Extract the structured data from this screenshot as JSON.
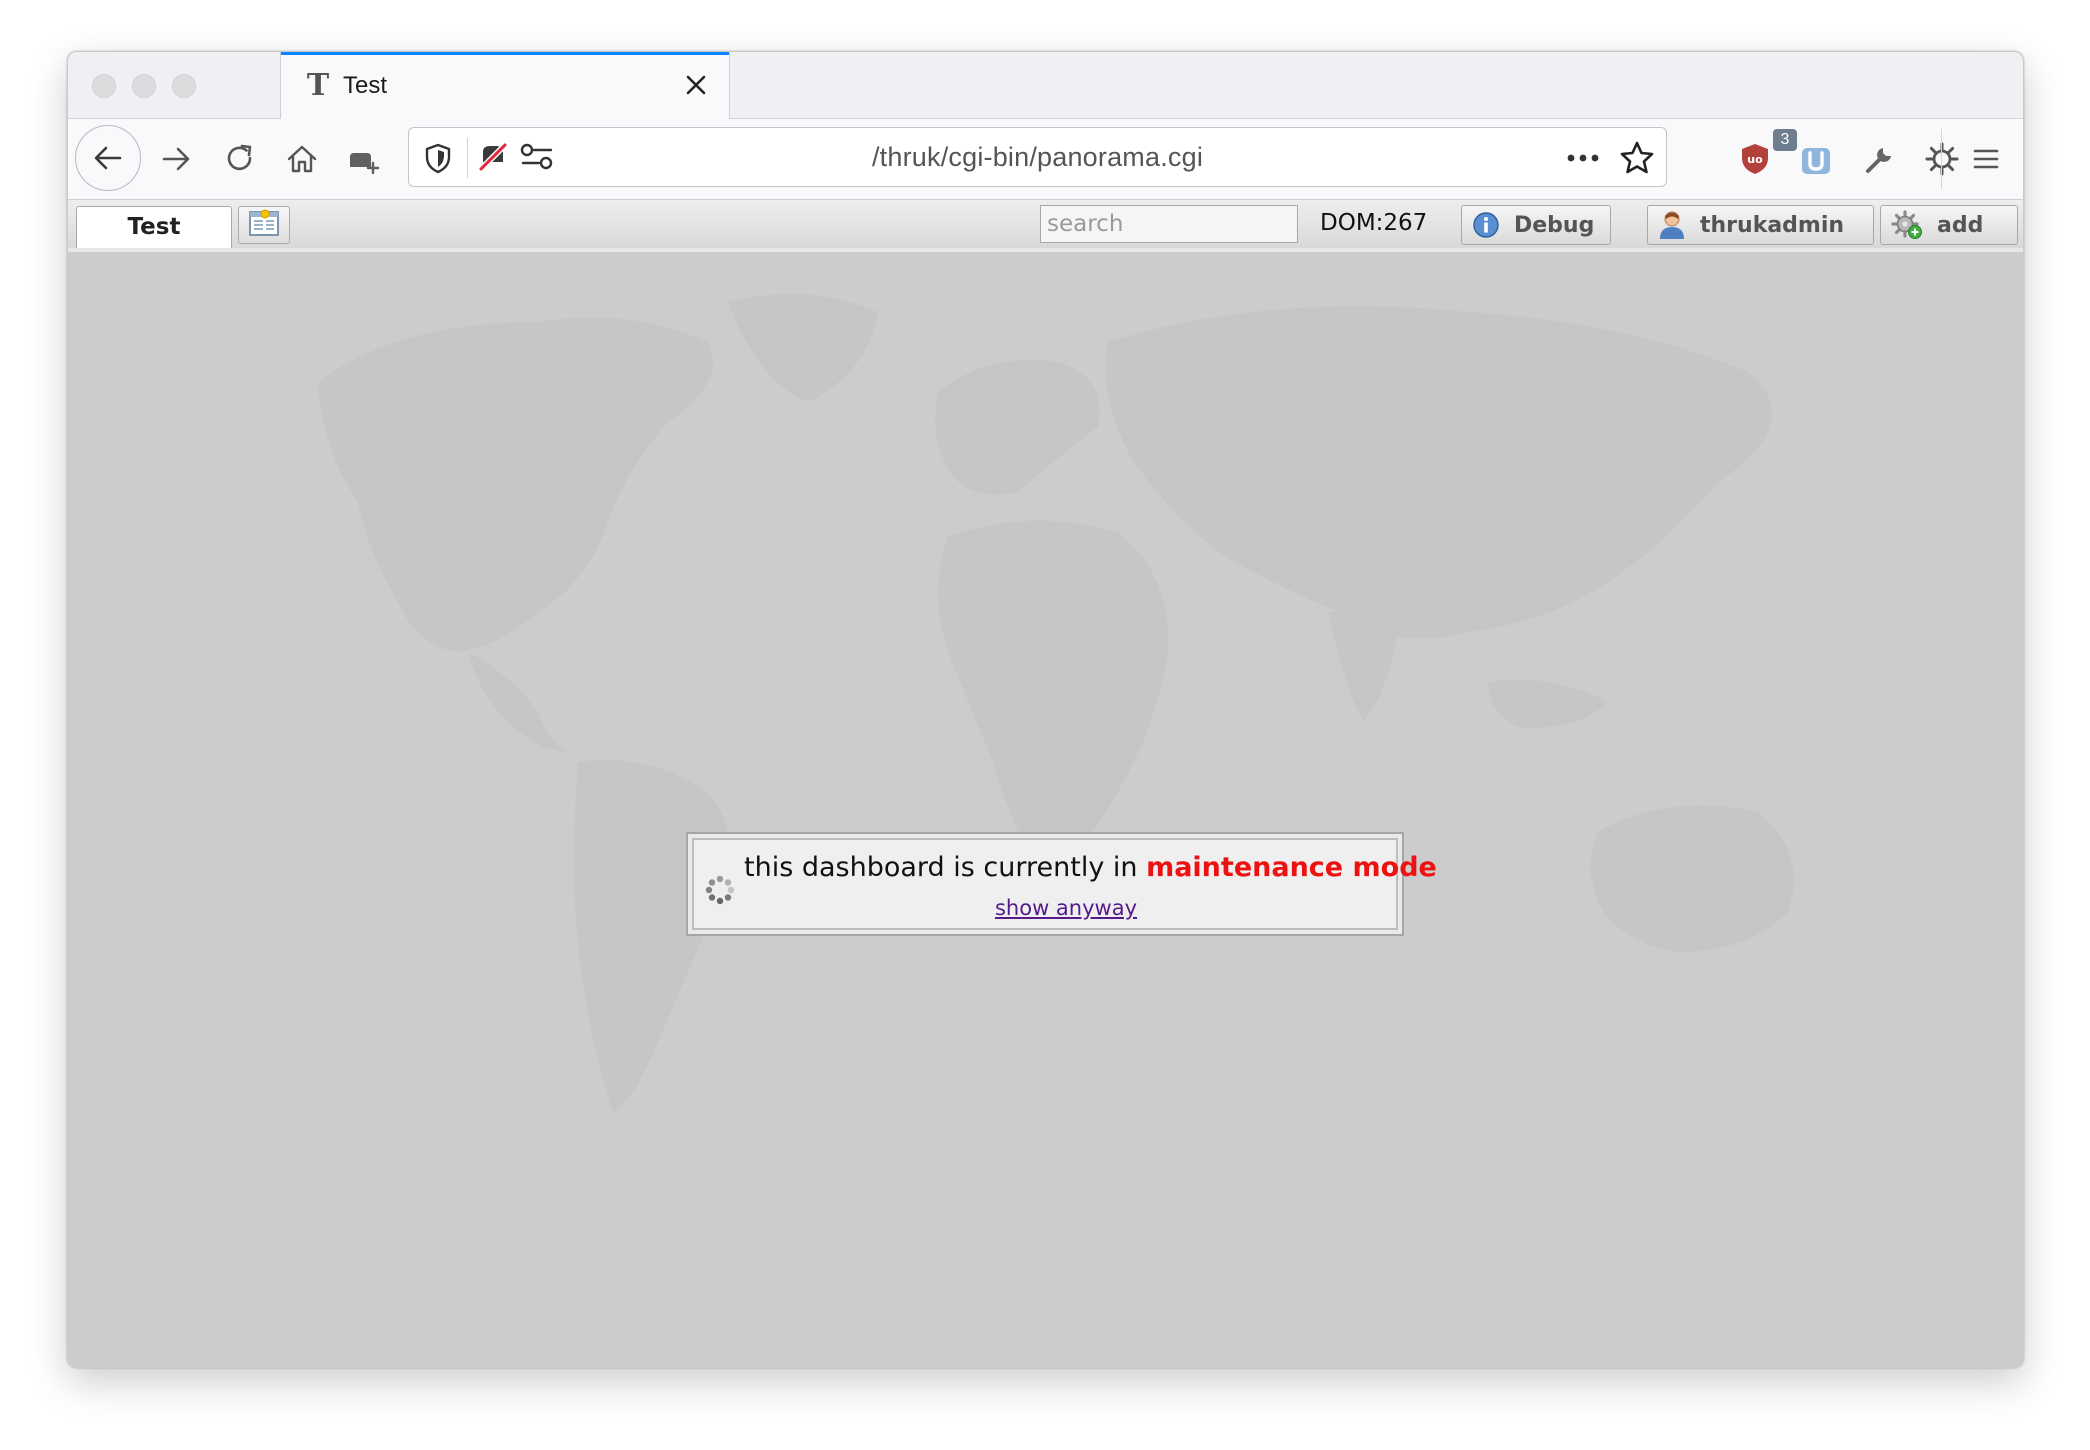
{
  "browser": {
    "tab": {
      "title": "Test",
      "favicon_letter": "T"
    },
    "url": "/thruk/cgi-bin/panorama.cgi",
    "extension_badge": "3",
    "icons": {
      "back": "back-arrow-icon",
      "forward": "forward-arrow-icon",
      "reload": "reload-icon",
      "home": "home-icon",
      "container": "container-icon",
      "shield": "tracking-protection-shield-icon",
      "permissions": "permissions-icon",
      "more": "page-actions-icon",
      "bookmark": "bookmark-star-icon",
      "ublock": "ublock-origin-icon",
      "extension": "extension-icon",
      "tools": "wrench-icon",
      "settings": "gear-icon",
      "menu": "hamburger-menu-icon"
    }
  },
  "panorama": {
    "tab_label": "Test",
    "search_placeholder": "search",
    "dom_count": "DOM:267",
    "debug_label": "Debug",
    "user_label": "thrukadmin",
    "add_label": "add"
  },
  "maintenance": {
    "prefix": "this dashboard is currently in ",
    "highlight": "maintenance mode",
    "link": "show anyway",
    "highlight_color": "#ee1111"
  }
}
